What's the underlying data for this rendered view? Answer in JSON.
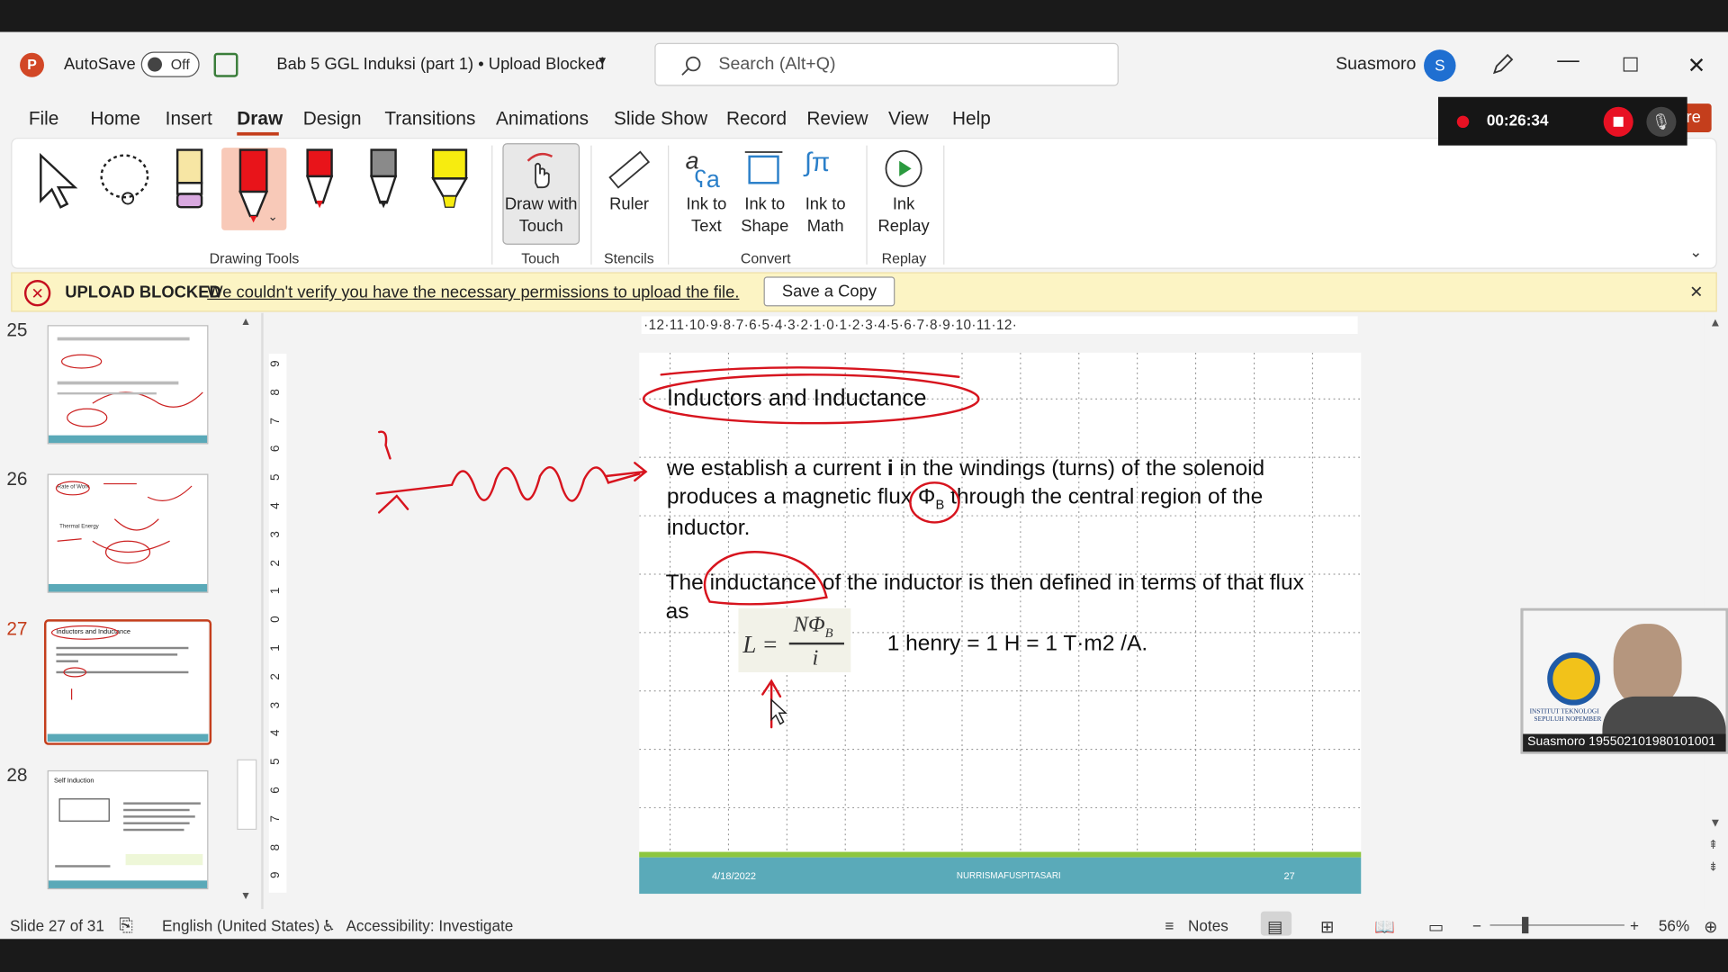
{
  "title_bar": {
    "autosave": "AutoSave",
    "toggle": "Off",
    "doc_title": "Bab 5 GGL Induksi (part 1) • Upload Blocked",
    "search_placeholder": "Search (Alt+Q)",
    "user": "Suasmoro",
    "avatar": "S"
  },
  "menu": [
    "File",
    "Home",
    "Insert",
    "Draw",
    "Design",
    "Transitions",
    "Animations",
    "Slide Show",
    "Record",
    "Review",
    "View",
    "Help"
  ],
  "active_menu": "Draw",
  "ribbon": {
    "groups": {
      "drawing_tools": "Drawing Tools",
      "touch": "Touch",
      "stencils": "Stencils",
      "convert": "Convert",
      "replay": "Replay"
    },
    "draw_touch": "Draw with Touch",
    "ruler": "Ruler",
    "ink_text": "Ink to Text",
    "ink_shape": "Ink to Shape",
    "ink_math": "Ink to Math",
    "ink_replay": "Ink Replay"
  },
  "upload_bar": {
    "heading": "UPLOAD BLOCKED",
    "message": "We couldn't verify you have the necessary permissions to upload the file.",
    "button": "Save a Copy"
  },
  "recording": {
    "time": "00:26:34",
    "share_fragment": "re"
  },
  "thumbnails": [
    {
      "num": "25"
    },
    {
      "num": "26"
    },
    {
      "num": "27"
    },
    {
      "num": "28"
    }
  ],
  "ruler_h": "·12·11·10·9·8·7·6·5·4·3·2·1·0·1·2·3·4·5·6·7·8·9·10·11·12·",
  "ruler_v": [
    "9",
    "8",
    "7",
    "6",
    "5",
    "4",
    "3",
    "2",
    "1",
    "0",
    "1",
    "2",
    "3",
    "4",
    "5",
    "6",
    "7",
    "8",
    "9"
  ],
  "slide": {
    "title": "Inductors and Inductance",
    "para1_a": "we establish a current",
    "para1_i": "i",
    "para1_b": "in the windings (turns) of the solenoid",
    "para1_c": "produces a magnetic flux",
    "phi": "Φ",
    "phi_sub": "B",
    "para1_d": "through the central region of the",
    "para1_e": "inductor.",
    "para2_a": "The inductance of the inductor is then defined in terms of that flux",
    "para2_b": "as",
    "formula_lhs": "L =",
    "formula_num": "NΦ",
    "formula_sub": "B",
    "formula_den": "i",
    "henry": "1 henry = 1 H = 1 T·m2 /A.",
    "footer_date": "4/18/2022",
    "footer_name": "NURRISMAFUSPITASARI",
    "footer_page": "27"
  },
  "webcam": {
    "name": "Suasmoro 195502101980101001",
    "logo_l1": "INSTITUT TEKNOLOGI",
    "logo_l2": "SEPULUH NOPEMBER"
  },
  "status": {
    "slide": "Slide 27 of 31",
    "lang": "English (United States)",
    "access": "Accessibility: Investigate",
    "notes": "Notes",
    "zoom": "56%"
  },
  "thumb_texts": {
    "t28_title": "Self Induction",
    "t27_title": "Inductors and Inductance",
    "t26_a": "Rate of Work",
    "t26_b": "Thermal Energy"
  }
}
